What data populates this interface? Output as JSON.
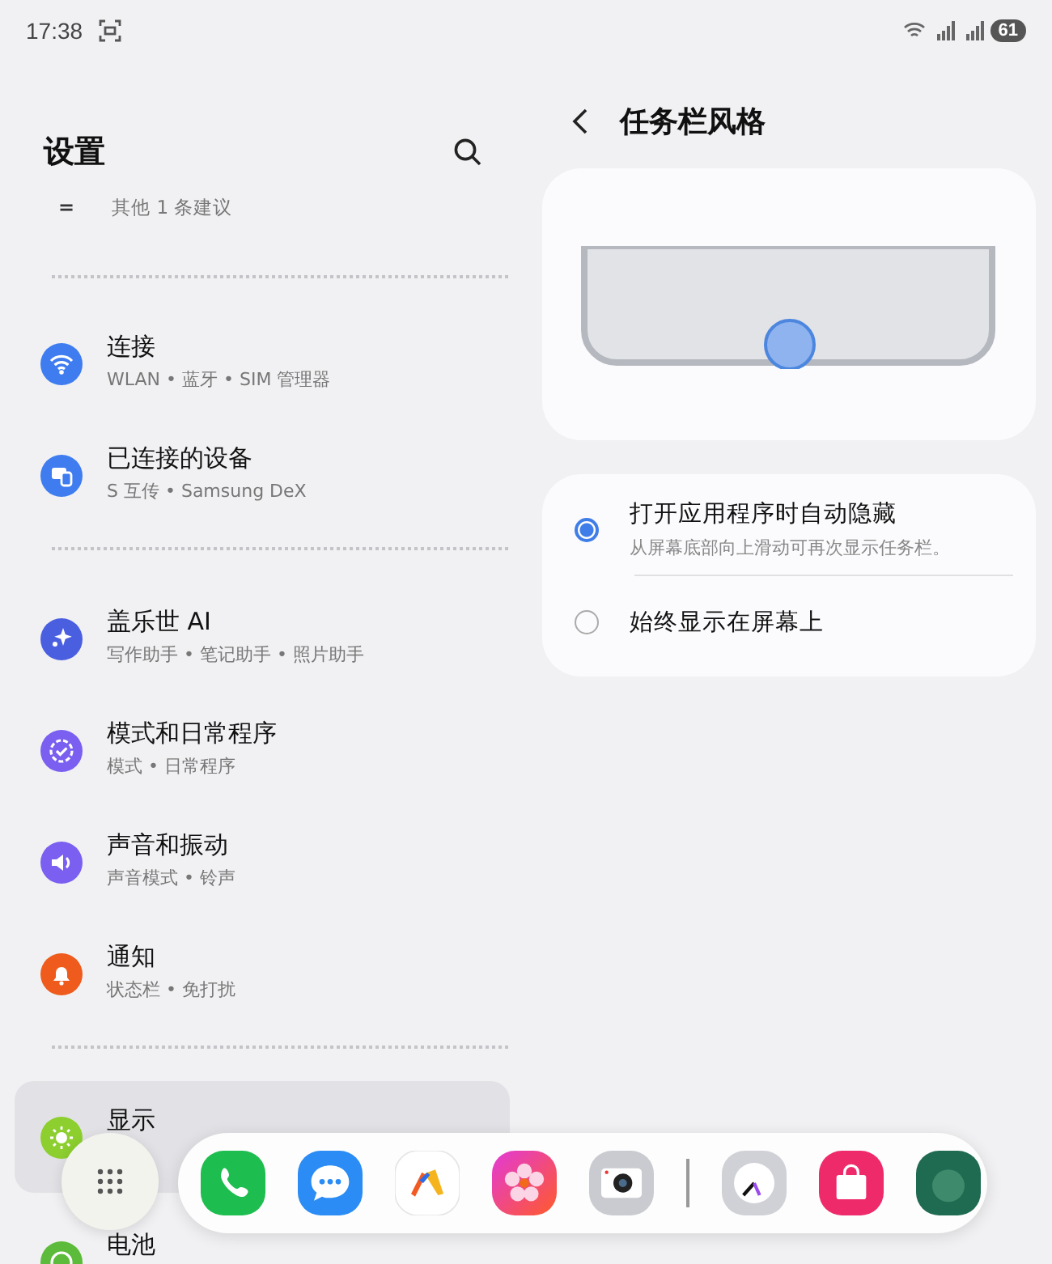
{
  "status_bar": {
    "time": "17:38",
    "battery": "61"
  },
  "sidebar": {
    "title": "设置",
    "suggestion": {
      "icon_text": "=",
      "label": "其他 1 条建议"
    },
    "groups": [
      {
        "items": [
          {
            "title": "连接",
            "subtitle": "WLAN • 蓝牙 • SIM 管理器",
            "color": "#3e7cf0",
            "selected": false
          },
          {
            "title": "已连接的设备",
            "subtitle": "S 互传 • Samsung DeX",
            "color": "#3e7cf0",
            "selected": false
          }
        ]
      },
      {
        "items": [
          {
            "title": "盖乐世 AI",
            "subtitle": "写作助手 • 笔记助手 • 照片助手",
            "color": "#4a5fe0",
            "selected": false
          },
          {
            "title": "模式和日常程序",
            "subtitle": "模式 • 日常程序",
            "color": "#7a5ff0",
            "selected": false
          },
          {
            "title": "声音和振动",
            "subtitle": "声音模式 • 铃声",
            "color": "#7a5ff0",
            "selected": false
          },
          {
            "title": "通知",
            "subtitle": "状态栏 • 免打扰",
            "color": "#ee5b1c",
            "selected": false
          }
        ]
      },
      {
        "items": [
          {
            "title": "显示",
            "color": "#8ccf2e",
            "selected": true
          },
          {
            "title": "电池",
            "color": "#5cbb3a",
            "selected": false
          }
        ]
      }
    ]
  },
  "detail": {
    "title": "任务栏风格",
    "options": [
      {
        "label": "打开应用程序时自动隐藏",
        "description": "从屏幕底部向上滑动可再次显示任务栏。",
        "selected": true
      },
      {
        "label": "始终显示在屏幕上",
        "selected": false
      }
    ]
  }
}
